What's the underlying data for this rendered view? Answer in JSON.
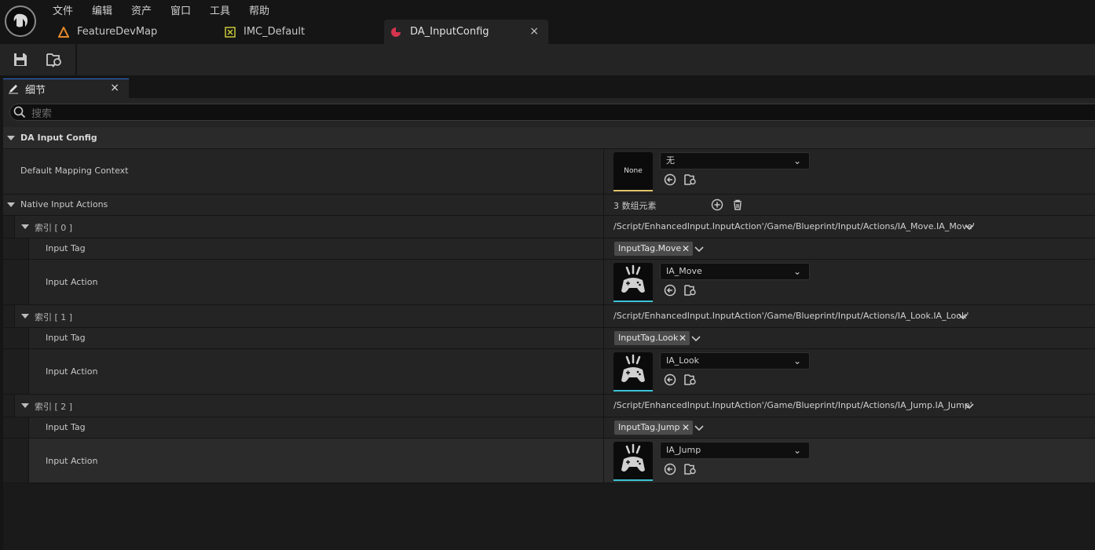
{
  "menu": [
    "文件",
    "编辑",
    "资产",
    "窗口",
    "工具",
    "帮助"
  ],
  "tabs": [
    {
      "label": "FeatureDevMap"
    },
    {
      "label": "IMC_Default"
    },
    {
      "label": "DA_InputConfig"
    }
  ],
  "tab_close_glyph": "×",
  "details_tab": {
    "label": "细节",
    "close": "×"
  },
  "search": {
    "placeholder": "搜索"
  },
  "category": {
    "label": "DA Input Config"
  },
  "default_mapping_context": {
    "label": "Default Mapping Context",
    "thumb_text": "None",
    "value": "无"
  },
  "native_input_actions": {
    "label": "Native Input Actions",
    "count_text": "3 数组元素",
    "items": [
      {
        "index_label": "索引 [ 0 ]",
        "path": "/Script/EnhancedInput.InputAction'/Game/Blueprint/Input/Actions/IA_Move.IA_Move'",
        "tag_label": "Input Tag",
        "tag_value": "InputTag.Move",
        "action_label": "Input Action",
        "action_value": "IA_Move"
      },
      {
        "index_label": "索引 [ 1 ]",
        "path": "/Script/EnhancedInput.InputAction'/Game/Blueprint/Input/Actions/IA_Look.IA_Look'",
        "tag_label": "Input Tag",
        "tag_value": "InputTag.Look",
        "action_label": "Input Action",
        "action_value": "IA_Look"
      },
      {
        "index_label": "索引 [ 2 ]",
        "path": "/Script/EnhancedInput.InputAction'/Game/Blueprint/Input/Actions/IA_Jump.IA_Jump'",
        "tag_label": "Input Tag",
        "tag_value": "InputTag.Jump",
        "action_label": "Input Action",
        "action_value": "IA_Jump"
      }
    ]
  },
  "colors": {
    "accent_blue": "#2b6fd6",
    "mapping_context_bar": "#e0c36a",
    "input_action_bar": "#3cc3d6",
    "active_tab_icon": "#d4344f",
    "level_icon": "#e0882a",
    "imc_icon": "#c8c83a"
  }
}
